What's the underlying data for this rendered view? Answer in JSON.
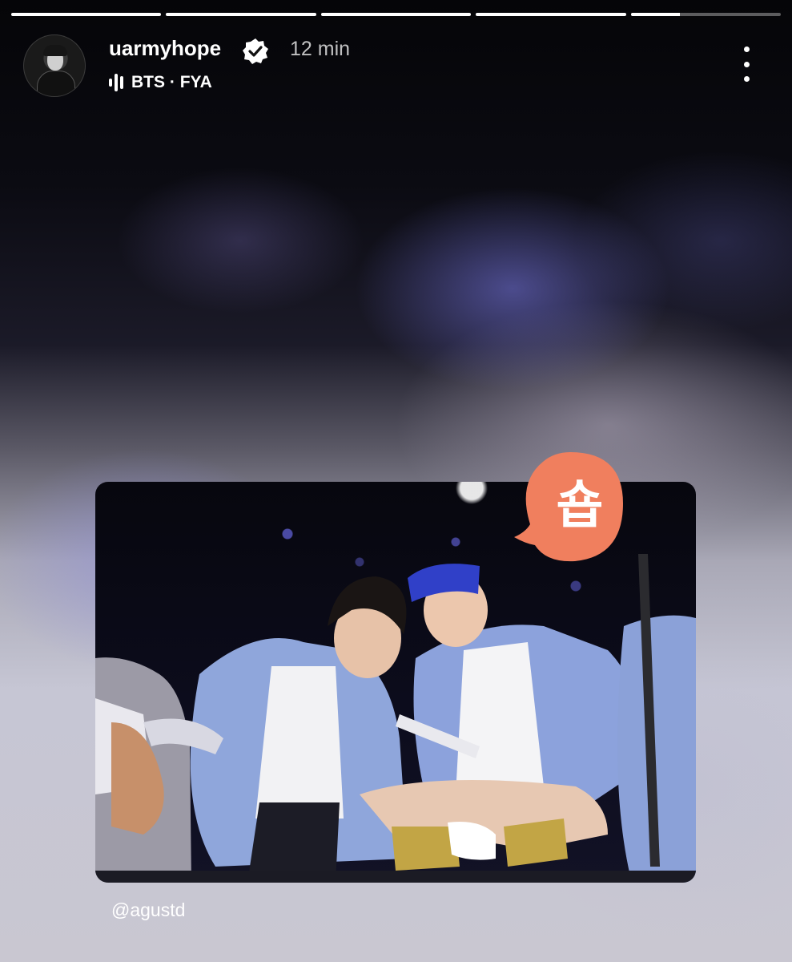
{
  "story": {
    "progress_segments": [
      1,
      1,
      1,
      1,
      0.33
    ]
  },
  "header": {
    "username": "uarmyhope",
    "time": "12 min",
    "verified_icon": "verified-badge-icon",
    "music": {
      "icon": "equalizer-icon",
      "artist": "BTS",
      "separator": "·",
      "track": "FYA"
    },
    "more_icon": "more-vertical-icon"
  },
  "content": {
    "sticker_text": "숍",
    "sticker_color": "#f07f5e",
    "mention": "@agustd"
  }
}
